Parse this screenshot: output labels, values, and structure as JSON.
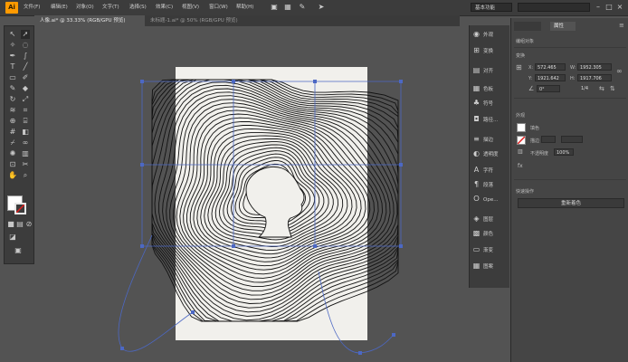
{
  "app": {
    "logo": "Ai"
  },
  "menus": [
    "文件(F)",
    "编辑(E)",
    "对象(O)",
    "文字(T)",
    "选择(S)",
    "效果(C)",
    "视图(V)",
    "窗口(W)",
    "帮助(H)"
  ],
  "workspace": "基本功能",
  "tabs": [
    "人像.ai* @ 33.33% (RGB/GPU 预览)",
    "未标题-1.ai* @ 50% (RGB/GPU 预览)"
  ],
  "dock_items": [
    "外观",
    "变换",
    "对齐",
    "色板",
    "符号",
    "路径...",
    "描边",
    "透明度",
    "字符",
    "段落",
    "Ope...",
    "图层",
    "颜色",
    "渐变",
    "图案"
  ],
  "panel": {
    "tabs": [
      "",
      "属性"
    ],
    "selection_label": "编组对象",
    "transform_label": "变换",
    "x": "572.465",
    "y": "1921.642",
    "w": "1952.305",
    "h": "1917.706",
    "angle": "0°",
    "ratio": "1/4",
    "appearance_label": "外观",
    "fill_label": "填色",
    "stroke_label": "描边",
    "opacity_label": "不透明度",
    "opacity_value": "100%",
    "quick_actions_label": "快速操作",
    "recolor_button": "重新着色"
  },
  "colors": {
    "accent": "#ff9a00",
    "selection": "#4c68c4",
    "artboard": "#f1f0ec"
  }
}
